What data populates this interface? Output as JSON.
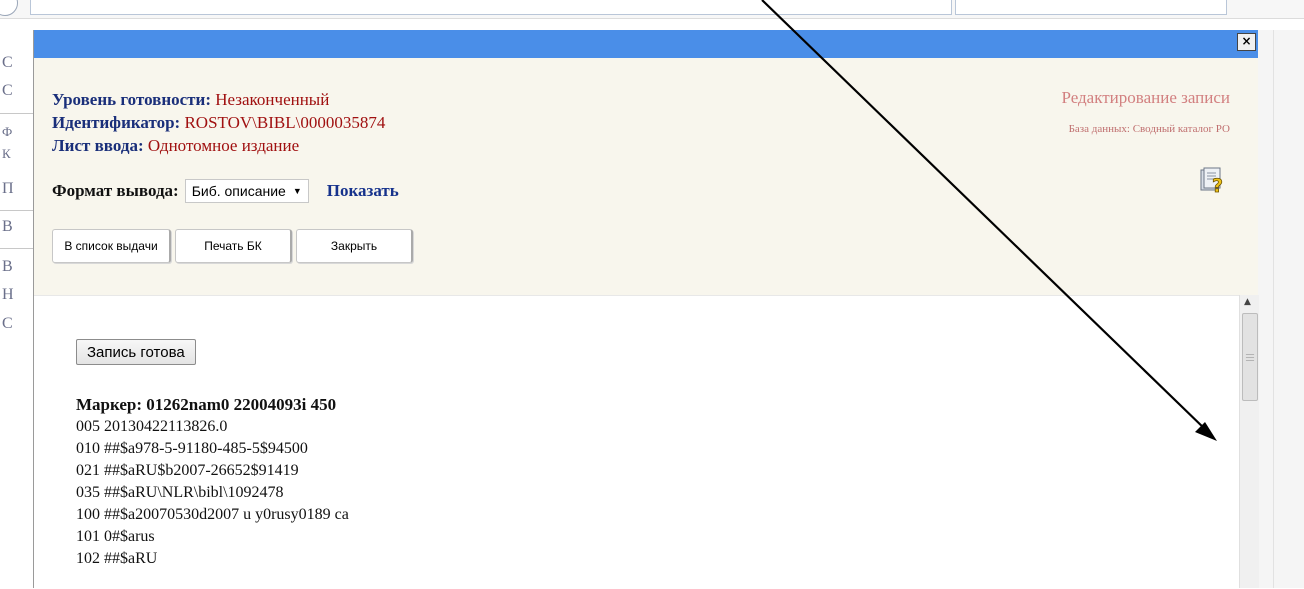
{
  "background": {
    "letters": [
      "С",
      "С",
      "Ф",
      "К",
      "П",
      "В",
      "В",
      "Н",
      "С"
    ]
  },
  "dialog": {
    "close_label": "×",
    "status_label": "Уровень готовности:",
    "status_value": "Незаконченный",
    "id_label": "Идентификатор:",
    "id_value": "ROSTOV\\BIBL\\0000035874",
    "sheet_label": "Лист ввода:",
    "sheet_value": "Однотомное издание",
    "edit_title": "Редактирование записи",
    "database_line": "База данных: Сводный каталог РО",
    "format_label": "Формат вывода:",
    "format_value": "Биб. описание",
    "show_link": "Показать",
    "buttons": {
      "issue_list": "В список выдачи",
      "print_bk": "Печать БК",
      "close": "Закрыть"
    },
    "record_ready_button": "Запись готова",
    "marker_line": "Маркер: 01262nam0 22004093i 450",
    "record_lines": [
      "005 20130422113826.0",
      "010 ##$a978-5-91180-485-5$94500",
      "021 ##$aRU$b2007-26652$91419",
      "035 ##$aRU\\NLR\\bibl\\1092478",
      "100 ##$a20070530d2007 u y0rusy0189 ca",
      "101 0#$arus",
      "102 ##$aRU"
    ]
  },
  "colors": {
    "titlebar": "#4a8ee8",
    "header_bg": "#f8f6ed",
    "label": "#1a2f7a",
    "value": "#a01010",
    "edit_title": "#d28080"
  },
  "icons": {
    "help": "help-icon",
    "close": "close-icon",
    "dropdown": "chevron-down-icon",
    "annotation": "annotation-arrow"
  }
}
